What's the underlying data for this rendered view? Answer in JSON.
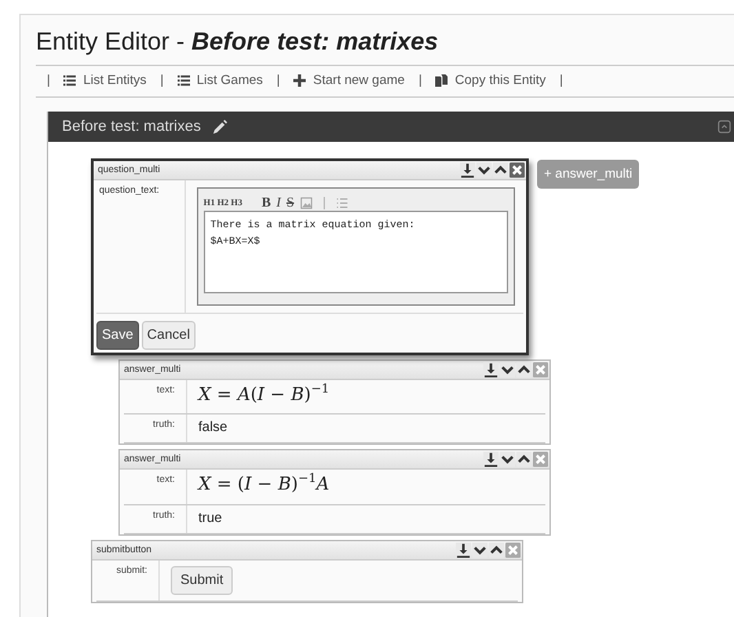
{
  "page": {
    "title": "Entity Editor - ",
    "title_entity": "Before test: matrixes"
  },
  "nav": [
    {
      "kind": "separator",
      "label": "|"
    },
    {
      "kind": "list_link",
      "label": "List Entitys"
    },
    {
      "kind": "separator",
      "label": "|"
    },
    {
      "kind": "list_link",
      "label": "List Games"
    },
    {
      "kind": "separator",
      "label": "|"
    },
    {
      "kind": "plus_link",
      "label": "Start new game"
    },
    {
      "kind": "separator",
      "label": "|"
    },
    {
      "kind": "copy_link",
      "label": "Copy this Entity"
    },
    {
      "kind": "separator",
      "label": "|"
    }
  ],
  "entity_bar": {
    "title": "Before test: matrixes"
  },
  "question": {
    "type": "question_multi",
    "focused": true,
    "field_label": "question_text:",
    "toolbar": {
      "headings": "H1 H2 H3",
      "bold": "B",
      "italic": "I",
      "strike": "S"
    },
    "text_lines": [
      "There is a matrix equation given:",
      "$A+BX=X$"
    ],
    "save": "Save",
    "cancel": "Cancel"
  },
  "add_button": "+ answer_multi",
  "answers": [
    {
      "type": "answer_multi",
      "focused": false,
      "text_label": "text:",
      "text": "*X* = *A*(*I* − *B*)$^{−1}$",
      "truth_label": "truth:",
      "truth": "false"
    },
    {
      "type": "answer_multi",
      "focused": false,
      "text_label": "text:",
      "text": "*X* = (*I* − *B*)$^{−1}$*A*",
      "truth_label": "truth:",
      "truth": "true"
    }
  ],
  "submit": {
    "type": "submitbutton",
    "focused": false,
    "label": "submit:",
    "button": "Submit"
  }
}
